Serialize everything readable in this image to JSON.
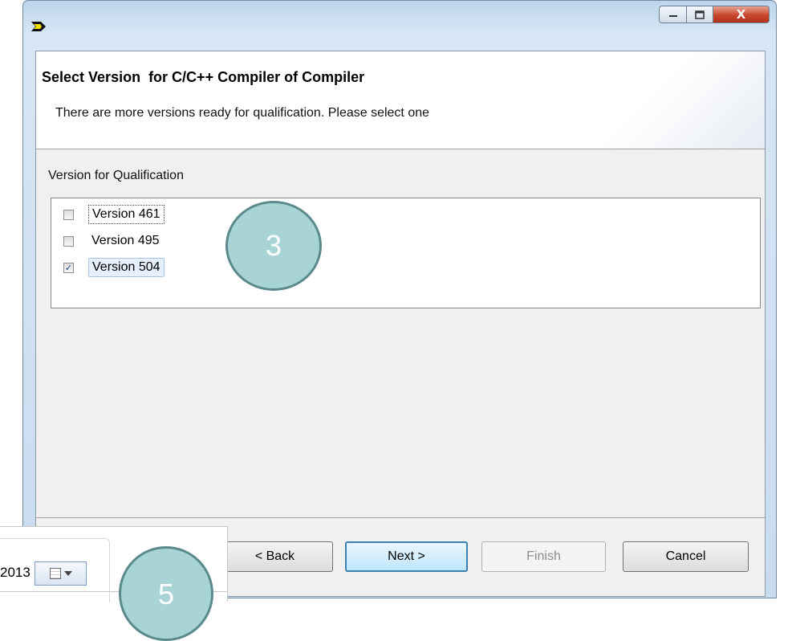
{
  "window": {
    "icon": "app-logo-icon",
    "controls": {
      "minimize_icon": "minimize-icon",
      "maximize_icon": "maximize-icon",
      "close_label": "X"
    }
  },
  "header": {
    "title": "Select Version  for C/C++ Compiler of Compiler",
    "description": "There are more versions ready for qualification. Please select one"
  },
  "versions": {
    "group_label": "Version for Qualification",
    "items": [
      {
        "label": "Version 461",
        "checked": false,
        "check_mark": ""
      },
      {
        "label": "Version 495",
        "checked": false,
        "check_mark": ""
      },
      {
        "label": "Version 504",
        "checked": true,
        "check_mark": "✓"
      }
    ]
  },
  "buttons": {
    "back": "< Back",
    "next": "Next >",
    "finish": "Finish",
    "cancel": "Cancel"
  },
  "annotations": {
    "circle_3": "3",
    "circle_5": "5"
  },
  "overlay": {
    "date_fragment": "2013",
    "calendar_icon": "calendar-icon",
    "dropdown_icon": "chevron-down-icon"
  },
  "colors": {
    "accent": "#3c7fb1",
    "callout_fill": "#a8d4d6",
    "callout_border": "#5b8a8c",
    "close": "#c7462b"
  }
}
